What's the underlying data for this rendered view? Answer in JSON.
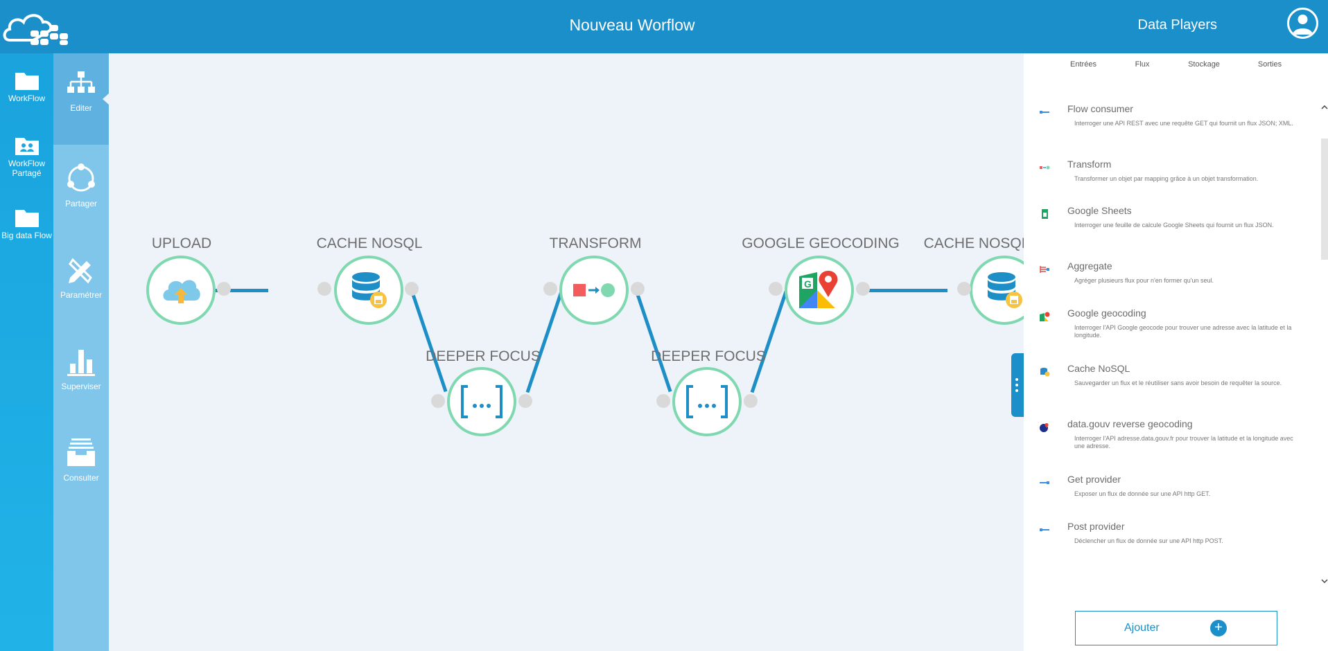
{
  "header": {
    "title": "Nouveau Worflow",
    "user": "Data Players"
  },
  "nav_primary": [
    {
      "label": "WorkFlow",
      "icon": "folder-icon"
    },
    {
      "label": "WorkFlow Partagé",
      "icon": "shared-users-folder-icon"
    },
    {
      "label": "Big data Flow",
      "icon": "folder-icon"
    }
  ],
  "nav_secondary": [
    {
      "label": "Editer",
      "icon": "sitemap-icon",
      "active": true
    },
    {
      "label": "Partager",
      "icon": "share-circle-icon"
    },
    {
      "label": "Paramétrer",
      "icon": "settings-tools-icon"
    },
    {
      "label": "Superviser",
      "icon": "bar-chart-icon"
    },
    {
      "label": "Consulter",
      "icon": "inbox-icon"
    }
  ],
  "workflow": {
    "nodes": [
      {
        "label": "UPLOAD",
        "icon": "cloud-upload-icon"
      },
      {
        "label": "CACHE NOSQL",
        "icon": "database-icon"
      },
      {
        "label": "DEEPER FOCUS",
        "icon": "brackets-icon"
      },
      {
        "label": "TRANSFORM",
        "icon": "transform-icon"
      },
      {
        "label": "DEEPER FOCUS",
        "icon": "brackets-icon"
      },
      {
        "label": "GOOGLE GEOCODING",
        "icon": "google-maps-icon"
      },
      {
        "label": "CACHE NOSQL",
        "icon": "database-icon"
      }
    ]
  },
  "panel": {
    "tabs": [
      "Entrées",
      "Flux",
      "Stockage",
      "Sorties"
    ],
    "items": [
      {
        "title": "Flow consumer",
        "description": "Interroger une API REST avec une requête GET qui fournit un flux JSON; XML.",
        "icon": "plug-icon",
        "color": "#3b8ee0"
      },
      {
        "title": "Transform",
        "description": "Transformer un objet par mapping grâce à un objet transformation.",
        "icon": "transform-icon",
        "color": "#f25c5c"
      },
      {
        "title": "Google Sheets",
        "description": "Interroger une feuille de calcule Google Sheets qui fournit un flux JSON.",
        "icon": "sheets-icon",
        "color": "#1fa463"
      },
      {
        "title": "Aggregate",
        "description": "Agréger plusieurs flux pour n'en former qu'un seul.",
        "icon": "aggregate-icon",
        "color": "#d9534f"
      },
      {
        "title": "Google geocoding",
        "description": "Interroger l'API Google geocode pour trouver une adresse avec la latitude et la longitude.",
        "icon": "google-maps-icon",
        "color": "#e94235"
      },
      {
        "title": "Cache NoSQL",
        "description": "Sauvegarder un flux et le réutiliser sans avoir besoin de requêter la source.",
        "icon": "database-icon",
        "color": "#2a87c8"
      },
      {
        "title": "data.gouv reverse geocoding",
        "description": "Interroger l'API adresse.data.gouv.fr pour trouver la latitude et la longitude avec une adresse.",
        "icon": "geo-pin-icon",
        "color": "#1d2f8a"
      },
      {
        "title": "Get provider",
        "description": "Exposer un flux de donnée sur une API http GET.",
        "icon": "plug-out-icon",
        "color": "#3b8ee0"
      },
      {
        "title": "Post provider",
        "description": "Déclencher un flux de donnée sur une API http POST.",
        "icon": "plug-out-icon",
        "color": "#3b8ee0"
      }
    ],
    "add_label": "Ajouter"
  }
}
